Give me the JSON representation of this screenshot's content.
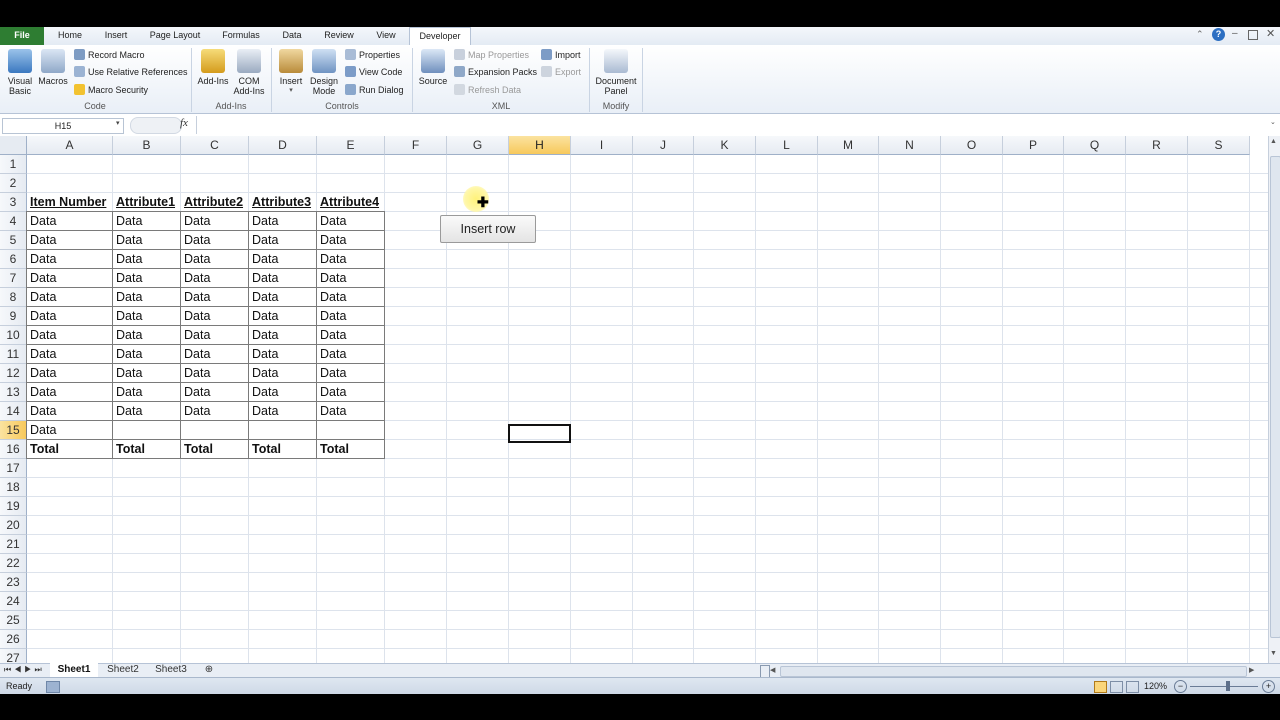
{
  "ribbon": {
    "tabs": [
      "File",
      "Home",
      "Insert",
      "Page Layout",
      "Formulas",
      "Data",
      "Review",
      "View",
      "Developer"
    ],
    "active_tab": "Developer",
    "groups": {
      "code": {
        "label": "Code",
        "visual_basic": "Visual\nBasic",
        "macros": "Macros",
        "record_macro": "Record Macro",
        "use_relative": "Use Relative References",
        "macro_security": "Macro Security"
      },
      "addins": {
        "label": "Add-Ins",
        "add_ins": "Add-Ins",
        "com_add_ins": "COM\nAdd-Ins"
      },
      "controls": {
        "label": "Controls",
        "insert": "Insert",
        "design_mode": "Design\nMode",
        "properties": "Properties",
        "view_code": "View Code",
        "run_dialog": "Run Dialog"
      },
      "xml": {
        "label": "XML",
        "source": "Source",
        "map_properties": "Map Properties",
        "expansion_packs": "Expansion Packs",
        "refresh_data": "Refresh Data",
        "import": "Import",
        "export": "Export"
      },
      "modify": {
        "label": "Modify",
        "document_panel": "Document\nPanel"
      }
    }
  },
  "formula_bar": {
    "name_box": "H15",
    "fx": "fx",
    "content": ""
  },
  "columns": [
    "A",
    "B",
    "C",
    "D",
    "E",
    "F",
    "G",
    "H",
    "I",
    "J",
    "K",
    "L",
    "M",
    "N",
    "O",
    "P",
    "Q",
    "R",
    "S"
  ],
  "selected_column": "H",
  "rows": [
    "1",
    "2",
    "3",
    "4",
    "5",
    "6",
    "7",
    "8",
    "9",
    "10",
    "11",
    "12",
    "13",
    "14",
    "15",
    "16",
    "17",
    "18",
    "19",
    "20",
    "21",
    "22",
    "23",
    "24",
    "25",
    "26",
    "27"
  ],
  "selected_row": "15",
  "table": {
    "headers": [
      "Item Number",
      "Attribute1",
      "Attribute2",
      "Attribute3",
      "Attribute4"
    ],
    "body": [
      [
        "Data",
        "Data",
        "Data",
        "Data",
        "Data"
      ],
      [
        "Data",
        "Data",
        "Data",
        "Data",
        "Data"
      ],
      [
        "Data",
        "Data",
        "Data",
        "Data",
        "Data"
      ],
      [
        "Data",
        "Data",
        "Data",
        "Data",
        "Data"
      ],
      [
        "Data",
        "Data",
        "Data",
        "Data",
        "Data"
      ],
      [
        "Data",
        "Data",
        "Data",
        "Data",
        "Data"
      ],
      [
        "Data",
        "Data",
        "Data",
        "Data",
        "Data"
      ],
      [
        "Data",
        "Data",
        "Data",
        "Data",
        "Data"
      ],
      [
        "Data",
        "Data",
        "Data",
        "Data",
        "Data"
      ],
      [
        "Data",
        "Data",
        "Data",
        "Data",
        "Data"
      ],
      [
        "Data",
        "Data",
        "Data",
        "Data",
        "Data"
      ],
      [
        "Data",
        "",
        "",
        "",
        ""
      ]
    ],
    "totals": [
      "Total",
      "Total",
      "Total",
      "Total",
      "Total"
    ]
  },
  "insert_button_label": "Insert row",
  "sheets": [
    "Sheet1",
    "Sheet2",
    "Sheet3"
  ],
  "active_sheet": "Sheet1",
  "status": {
    "ready": "Ready",
    "zoom": "120%"
  },
  "colors": {
    "file_tab": "#2e7d32",
    "selected_header": "#f7c95c"
  }
}
